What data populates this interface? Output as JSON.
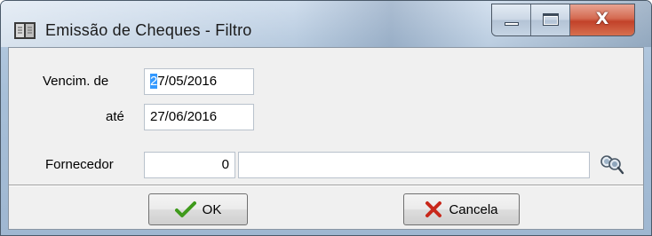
{
  "window": {
    "title": "Emissão de Cheques - Filtro",
    "icon": "book-icon",
    "caption_buttons": [
      "minimize-icon",
      "maximize-icon",
      "close-icon"
    ],
    "close_glyph": "X"
  },
  "form": {
    "vencim_label": "Vencim. de",
    "vencim_value_first": "2",
    "vencim_value_rest": "7/05/2016",
    "ate_label": "até",
    "ate_value": "27/06/2016",
    "fornecedor_label": "Fornecedor",
    "fornecedor_code": "0",
    "fornecedor_name": "",
    "search_icon": "binoculars-search-icon"
  },
  "buttons": {
    "ok_label": "OK",
    "ok_icon": "check-icon",
    "cancel_label": "Cancela",
    "cancel_icon": "x-mark-icon"
  },
  "colors": {
    "selection": "#3399ff",
    "ok_check": "#3f9a1c",
    "cancel_x": "#c8281b",
    "close_button": "#c2422a"
  }
}
